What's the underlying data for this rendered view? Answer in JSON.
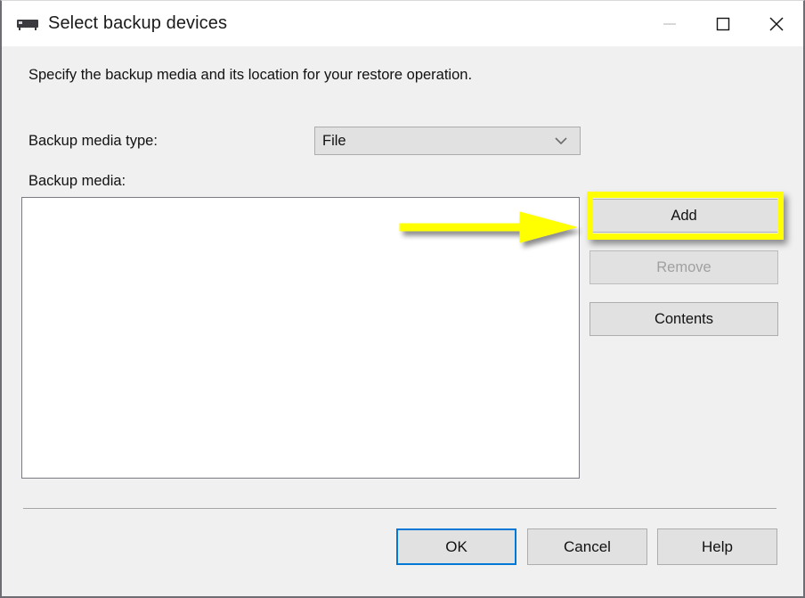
{
  "window": {
    "title": "Select backup devices",
    "icon": "tape-drive-icon",
    "controls": {
      "minimize_label": "—",
      "maximize_label": "□",
      "close_label": "✕"
    }
  },
  "body": {
    "instruction": "Specify the backup media and its location for your restore operation.",
    "media_type": {
      "label": "Backup media type:",
      "value": "File",
      "placeholder": "File",
      "chevron_icon": "chevron-down-icon"
    },
    "media_list": {
      "label": "Backup media:",
      "items": []
    },
    "side_buttons": [
      {
        "label": "Add",
        "enabled": true,
        "highlighted": true
      },
      {
        "label": "Remove",
        "enabled": false,
        "highlighted": false
      },
      {
        "label": "Contents",
        "enabled": true,
        "highlighted": false
      }
    ]
  },
  "footer": {
    "buttons": [
      {
        "label": "OK",
        "focused": true
      },
      {
        "label": "Cancel",
        "focused": false
      },
      {
        "label": "Help",
        "focused": false
      }
    ]
  },
  "annotations": {
    "arrow": {
      "shape": "right-arrow",
      "color": "#ffff00",
      "points_to": "Add"
    },
    "highlight_box": {
      "shape": "rectangle-outline",
      "color": "#ffff00",
      "targets": "Add"
    }
  },
  "colors": {
    "dialog_background": "#f0f0f0",
    "titlebar_background": "#ffffff",
    "button_face": "#e1e1e1",
    "listbox_background": "#ffffff",
    "focus_accent": "#0078d7",
    "annotation_yellow": "#ffff00",
    "disabled_text": "#a0a0a0"
  }
}
